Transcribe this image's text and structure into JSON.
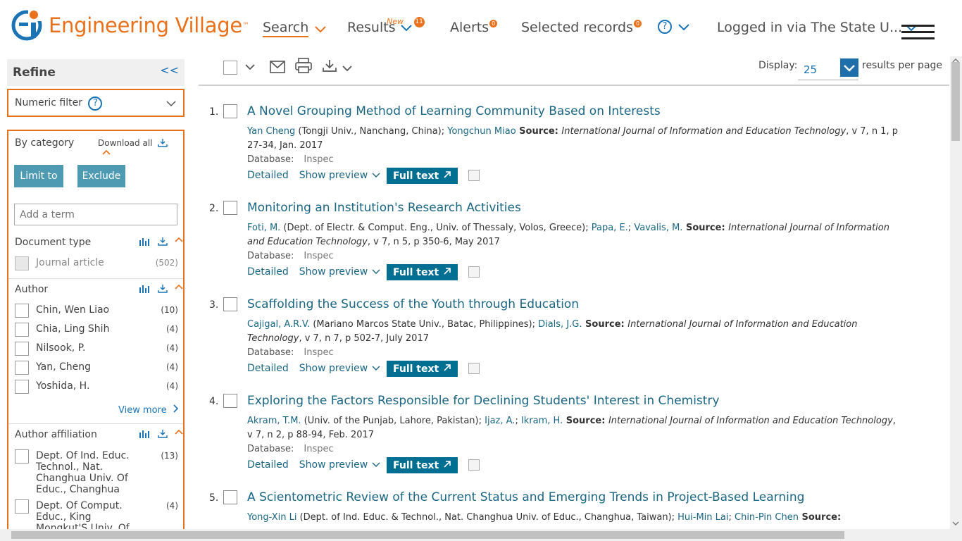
{
  "header": {
    "logo_text": "Engineering Village",
    "logo_tm": "™",
    "nav_search": "Search",
    "nav_results": "Results",
    "results_new": "New",
    "results_badge": "11",
    "nav_alerts": "Alerts",
    "alerts_badge": "0",
    "nav_selected": "Selected records",
    "selected_badge": "0",
    "nav_help": "?",
    "login": "Logged in via The State U..."
  },
  "sidebar": {
    "refine": "Refine",
    "collapse": "<<",
    "numeric_filter": "Numeric filter",
    "help": "?",
    "by_category": "By category",
    "download_all": "Download all",
    "limit_to": "Limit to",
    "exclude": "Exclude",
    "add_term_placeholder": "Add a term",
    "document_type": {
      "title": "Document type",
      "items": [
        {
          "name": "Journal article",
          "count": "(502)"
        }
      ]
    },
    "author": {
      "title": "Author",
      "items": [
        {
          "name": "Chin, Wen Liao",
          "count": "(10)"
        },
        {
          "name": "Chia, Ling Shih",
          "count": "(4)"
        },
        {
          "name": "Nilsook, P.",
          "count": "(4)"
        },
        {
          "name": "Yan, Cheng",
          "count": "(4)"
        },
        {
          "name": "Yoshida, H.",
          "count": "(4)"
        }
      ],
      "view_more": "View more"
    },
    "affiliation": {
      "title": "Author affiliation",
      "items": [
        {
          "name": "Dept. Of Ind. Educ. Technol., Nat. Changhua Univ. Of Educ., Changhua",
          "count": "(13)"
        },
        {
          "name": "Dept. Of Comput. Educ., King Mongkut'S Univ. Of",
          "count": "(4)"
        }
      ]
    }
  },
  "toolbar": {
    "display_label": "Display:",
    "display_value": "25",
    "results_per_page": "results per page"
  },
  "results": [
    {
      "num": "1.",
      "title": "A Novel Grouping Method of Learning Community Based on Interests",
      "authors_html_parts": [
        {
          "t": "a",
          "v": "Yan Cheng"
        },
        {
          "t": "p",
          "v": " (Tongji Univ., Nanchang, China); "
        },
        {
          "t": "a",
          "v": "Yongchun Miao"
        },
        {
          "t": "s",
          "v": " Source: "
        },
        {
          "t": "i",
          "v": "International Journal of Information and Education Technology"
        },
        {
          "t": "p",
          "v": ", v 7, n 1, p 27-34, Jan. 2017"
        }
      ],
      "db_label": "Database:",
      "db": "Inspec",
      "detailed": "Detailed",
      "preview": "Show preview",
      "fulltext": "Full text"
    },
    {
      "num": "2.",
      "title": "Monitoring an Institution's Research Activities",
      "authors_html_parts": [
        {
          "t": "a",
          "v": "Foti, M."
        },
        {
          "t": "p",
          "v": " (Dept. of Electr. & Comput. Eng., Univ. of Thessaly, Volos, Greece); "
        },
        {
          "t": "a",
          "v": "Papa, E."
        },
        {
          "t": "p",
          "v": "; "
        },
        {
          "t": "a",
          "v": "Vavalis, M."
        },
        {
          "t": "s",
          "v": " Source: "
        },
        {
          "t": "i",
          "v": "International Journal of Information and Education Technology"
        },
        {
          "t": "p",
          "v": ", v 7, n 5, p 350-6, May 2017"
        }
      ],
      "db_label": "Database:",
      "db": "Inspec",
      "detailed": "Detailed",
      "preview": "Show preview",
      "fulltext": "Full text"
    },
    {
      "num": "3.",
      "title": "Scaffolding the Success of the Youth through Education",
      "authors_html_parts": [
        {
          "t": "a",
          "v": "Cajigal, A.R.V."
        },
        {
          "t": "p",
          "v": " (Mariano Marcos State Univ., Batac, Philippines); "
        },
        {
          "t": "a",
          "v": "Dials, J.G."
        },
        {
          "t": "s",
          "v": " Source: "
        },
        {
          "t": "i",
          "v": "International Journal of Information and Education Technology"
        },
        {
          "t": "p",
          "v": ", v 7, n 7, p 502-7, July 2017"
        }
      ],
      "db_label": "Database:",
      "db": "Inspec",
      "detailed": "Detailed",
      "preview": "Show preview",
      "fulltext": "Full text"
    },
    {
      "num": "4.",
      "title": "Exploring the Factors Responsible for Declining Students' Interest in Chemistry",
      "authors_html_parts": [
        {
          "t": "a",
          "v": "Akram, T.M."
        },
        {
          "t": "p",
          "v": " (Univ. of the Punjab, Lahore, Pakistan); "
        },
        {
          "t": "a",
          "v": "Ijaz, A."
        },
        {
          "t": "p",
          "v": "; "
        },
        {
          "t": "a",
          "v": "Ikram, H."
        },
        {
          "t": "s",
          "v": " Source: "
        },
        {
          "t": "i",
          "v": "International Journal of Information and Education Technology"
        },
        {
          "t": "p",
          "v": ", v 7, n 2, p 88-94, Feb. 2017"
        }
      ],
      "db_label": "Database:",
      "db": "Inspec",
      "detailed": "Detailed",
      "preview": "Show preview",
      "fulltext": "Full text"
    },
    {
      "num": "5.",
      "title": "A Scientometric Review of the Current Status and Emerging Trends in Project-Based Learning",
      "authors_html_parts": [
        {
          "t": "a",
          "v": "Yong-Xin Li"
        },
        {
          "t": "p",
          "v": " (Dept. of Ind. Educ. & Technol., Nat. Changhua Univ. of Educ., Changhua, Taiwan); "
        },
        {
          "t": "a",
          "v": "Hui-Min Lai"
        },
        {
          "t": "p",
          "v": "; "
        },
        {
          "t": "a",
          "v": "Chin-Pin Chen"
        },
        {
          "t": "s",
          "v": " Source:"
        }
      ],
      "db_label": "",
      "db": "",
      "detailed": "",
      "preview": "",
      "fulltext": ""
    }
  ],
  "colors": {
    "accent": "#e9711c",
    "link": "#1a6683",
    "teal_button": "#4e9ab3",
    "fulltext_button": "#006f91"
  }
}
